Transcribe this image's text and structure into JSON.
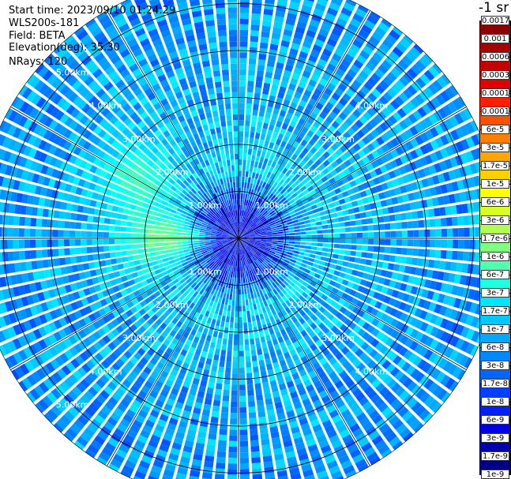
{
  "header": {
    "start_time": "Start time: 2023/09/10 01:24:29",
    "instrument": "WLS200s-181",
    "field": "Field: BETA",
    "elevation": "Elevation(deg): 35.30",
    "nrays": "NRays: 120"
  },
  "colorbar": {
    "unit_label": "-1 sr",
    "labels": [
      "0.0017",
      "0.001",
      "0.0006",
      "0.0003",
      "0.00017",
      "0.0001",
      "6e-5",
      "3e-5",
      "1.7e-5",
      "1e-5",
      "6e-6",
      "3e-6",
      "1.7e-6",
      "1e-6",
      "6e-7",
      "3e-7",
      "1.7e-7",
      "1e-7",
      "6e-8",
      "3e-8",
      "1.7e-8",
      "1e-8",
      "6e-9",
      "3e-9",
      "1.7e-9",
      "1e-9"
    ],
    "colors": [
      "#8b0000",
      "#a80000",
      "#c40000",
      "#e00000",
      "#ff2000",
      "#ff5000",
      "#ff7f00",
      "#ffa500",
      "#ffd000",
      "#ffff00",
      "#d8ff20",
      "#b0ff50",
      "#80ff80",
      "#50ffb0",
      "#20ffe0",
      "#00e5ff",
      "#00c8ff",
      "#00a8ff",
      "#0088ff",
      "#0066ff",
      "#0040ff",
      "#0020ff",
      "#0000e0",
      "#0000b0",
      "#000080"
    ]
  },
  "chart_data": {
    "type": "ppi_polar",
    "field": "BETA",
    "nrays": 120,
    "elevation_deg": 35.3,
    "range_rings_km": [
      "1.00km",
      "2.00km",
      "3.00km",
      "4.00km",
      "5.00km"
    ],
    "max_range_km": 5.6,
    "spoke_interval_deg": 30,
    "scale": "log",
    "value_range": [
      1e-09,
      0.0017
    ],
    "ring_mean_log10": [
      {
        "range_km": 0.5,
        "log10_beta": -8.2
      },
      {
        "range_km": 1.5,
        "log10_beta": -7.0
      },
      {
        "range_km": 2.5,
        "log10_beta": -7.1
      },
      {
        "range_km": 3.5,
        "log10_beta": -7.2
      },
      {
        "range_km": 4.5,
        "log10_beta": -7.25
      },
      {
        "range_km": 5.3,
        "log10_beta": -7.3
      }
    ],
    "features": [
      {
        "azimuth_deg": 300,
        "range_km": 2.5,
        "log10_beta": -6.3
      },
      {
        "azimuth_deg": 270,
        "range_km": 1.6,
        "log10_beta": -5.9
      }
    ]
  }
}
